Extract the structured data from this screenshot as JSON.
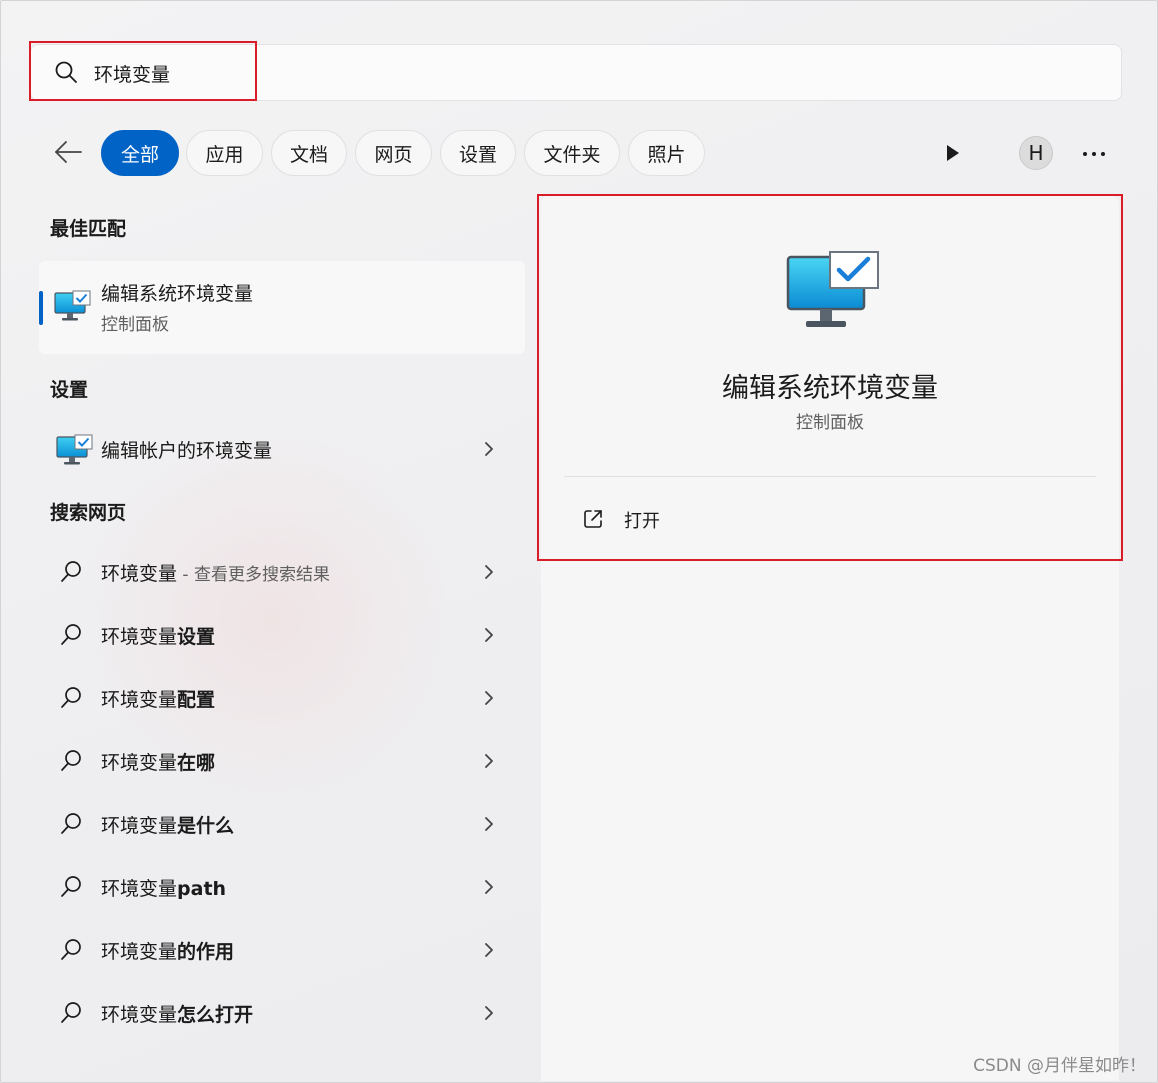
{
  "search": {
    "query": "环境变量",
    "placeholder": ""
  },
  "filters": {
    "chips": [
      {
        "label": "全部",
        "active": true
      },
      {
        "label": "应用",
        "active": false
      },
      {
        "label": "文档",
        "active": false
      },
      {
        "label": "网页",
        "active": false
      },
      {
        "label": "设置",
        "active": false
      },
      {
        "label": "文件夹",
        "active": false
      },
      {
        "label": "照片",
        "active": false
      }
    ],
    "avatar_initial": "H"
  },
  "best_match": {
    "heading": "最佳匹配",
    "title": "编辑系统环境变量",
    "subtitle": "控制面板"
  },
  "settings": {
    "heading": "设置",
    "items": [
      {
        "label": "编辑帐户的环境变量"
      }
    ]
  },
  "web": {
    "heading": "搜索网页",
    "items": [
      {
        "prefix": "环境变量",
        "bold": "",
        "suffix": " - 查看更多搜索结果"
      },
      {
        "prefix": "环境变量",
        "bold": "设置",
        "suffix": ""
      },
      {
        "prefix": "环境变量",
        "bold": "配置",
        "suffix": ""
      },
      {
        "prefix": "环境变量",
        "bold": "在哪",
        "suffix": ""
      },
      {
        "prefix": "环境变量",
        "bold": "是什么",
        "suffix": ""
      },
      {
        "prefix": "环境变量",
        "bold": "path",
        "suffix": ""
      },
      {
        "prefix": "环境变量",
        "bold": "的作用",
        "suffix": ""
      },
      {
        "prefix": "环境变量",
        "bold": "怎么打开",
        "suffix": ""
      }
    ]
  },
  "detail": {
    "title": "编辑系统环境变量",
    "subtitle": "控制面板",
    "actions": [
      {
        "label": "打开",
        "icon": "open-external-icon"
      }
    ]
  },
  "watermark": "CSDN @月伴星如昨！",
  "colors": {
    "accent": "#0063c5",
    "highlight": "#d81c28"
  }
}
